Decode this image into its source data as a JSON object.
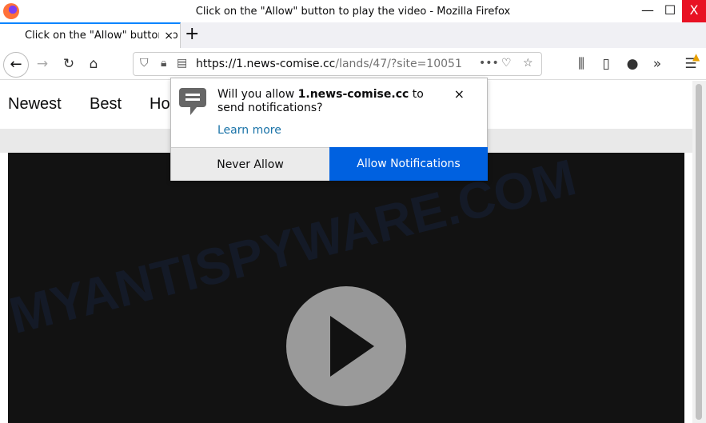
{
  "window": {
    "title": "Click on the \"Allow\" button to play the video - Mozilla Firefox",
    "minimize": "—",
    "maximize": "☐",
    "close": "X"
  },
  "tab": {
    "label": "Click on the \"Allow\" button to play the video",
    "close": "×",
    "new_tab": "+"
  },
  "nav": {
    "back": "←",
    "forward": "→",
    "reload": "↻",
    "home": "⌂",
    "url_host": "https://1.news-comise.cc",
    "url_path": "/lands/47/?site=10051",
    "more": "•••",
    "library": "⫼",
    "sidebar": "▯",
    "overflow": "»",
    "menu": "☰"
  },
  "site": {
    "nav": [
      "Newest",
      "Best",
      "Ho"
    ]
  },
  "popup": {
    "msg_prefix": "Will you allow ",
    "domain": "1.news-comise.cc",
    "msg_suffix": " to send notifications?",
    "learn_more": "Learn more",
    "close": "×",
    "never_allow": "Never Allow",
    "allow": "Allow Notifications"
  },
  "watermark": "MYANTISPYWARE.COM",
  "colors": {
    "allow_button": "#0061e0",
    "tab_accent": "#0a84ff",
    "close_button": "#e81123"
  }
}
